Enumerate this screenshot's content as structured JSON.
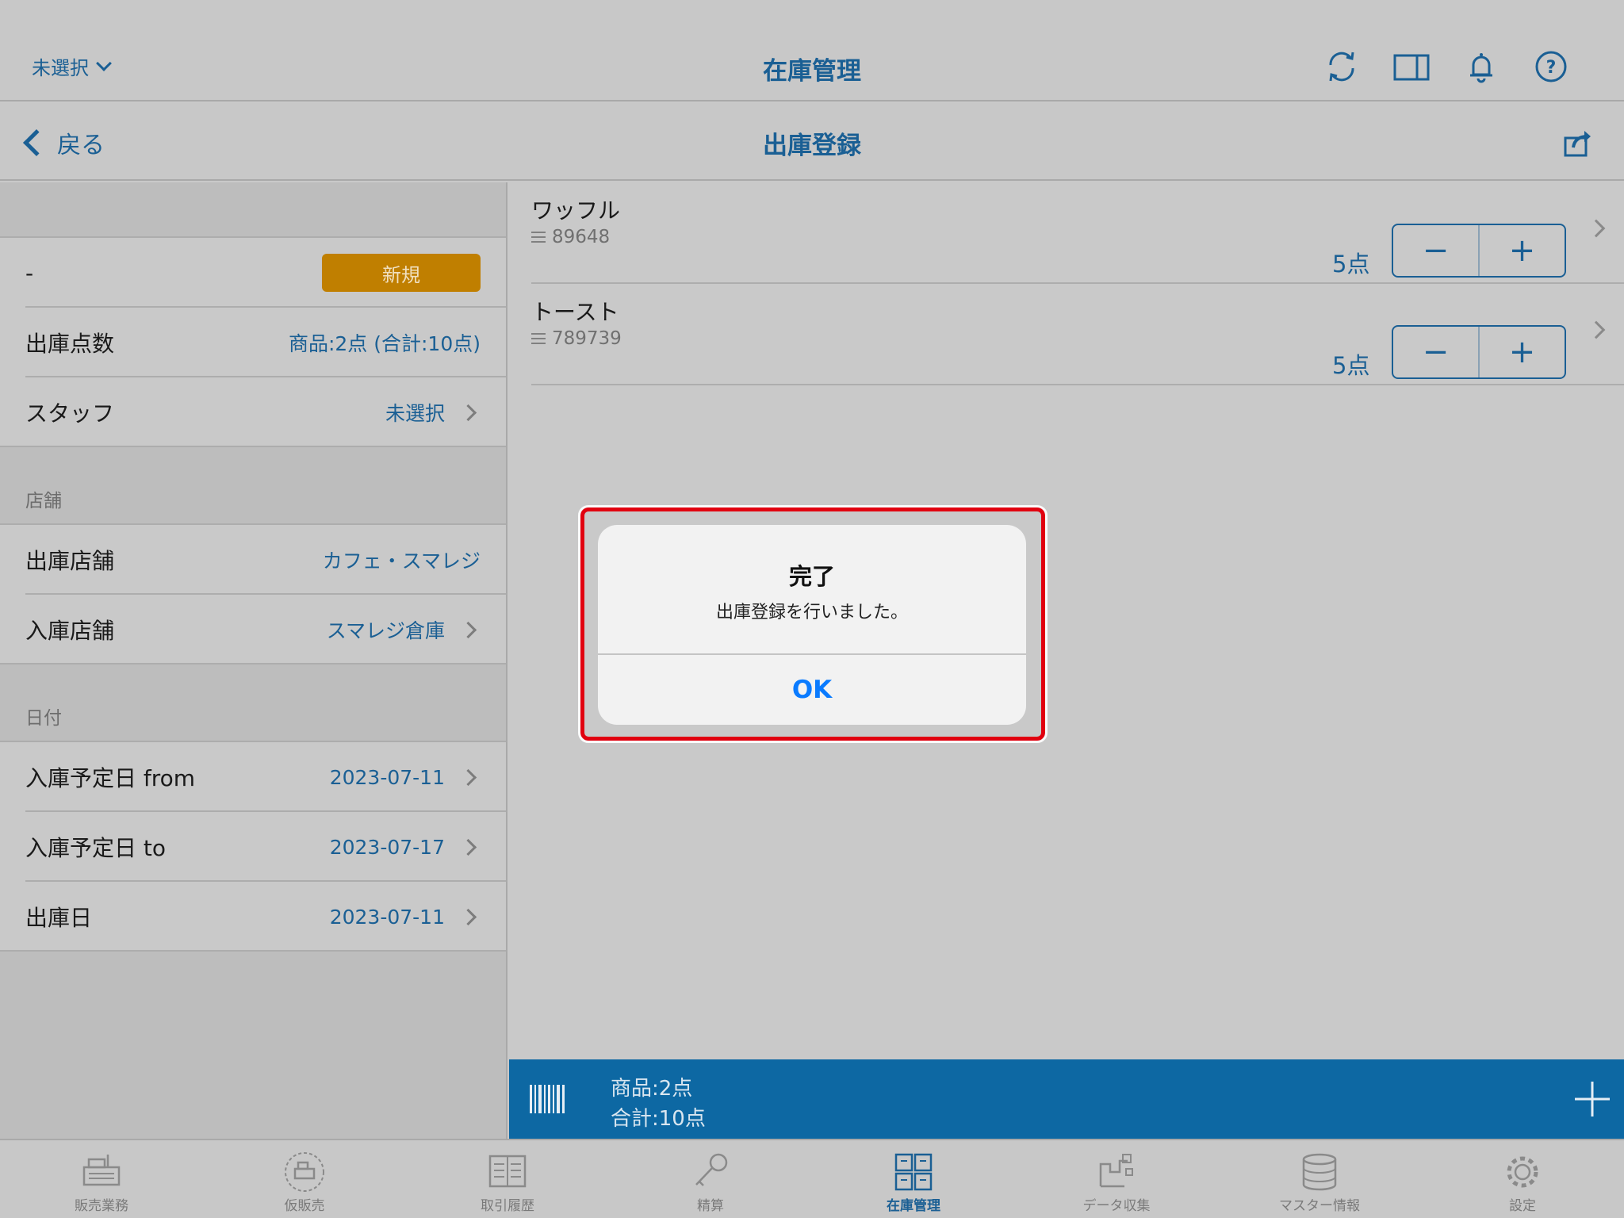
{
  "header": {
    "store_selector": "未選択",
    "title": "在庫管理",
    "icons": [
      "refresh-icon",
      "split-view-icon",
      "bell-icon",
      "help-icon"
    ]
  },
  "subheader": {
    "back_label": "戻る",
    "title": "出庫登録"
  },
  "form": {
    "id_value": "-",
    "status_badge": "新規",
    "count_label": "出庫点数",
    "count_value": "商品:2点 (合計:10点)",
    "staff_label": "スタッフ",
    "staff_value": "未選択",
    "store_section": "店舗",
    "from_store_label": "出庫店舗",
    "from_store_value": "カフェ・スマレジ",
    "to_store_label": "入庫店舗",
    "to_store_value": "スマレジ倉庫",
    "date_section": "日付",
    "date_from_label": "入庫予定日 from",
    "date_from_value": "2023-07-11",
    "date_to_label": "入庫予定日 to",
    "date_to_value": "2023-07-17",
    "ship_date_label": "出庫日",
    "ship_date_value": "2023-07-11"
  },
  "items": [
    {
      "name": "ワッフル",
      "code": "89648",
      "qty": "5点",
      "minus": "−",
      "plus": "+"
    },
    {
      "name": "トースト",
      "code": "789739",
      "qty": "5点",
      "minus": "−",
      "plus": "+"
    }
  ],
  "footer": {
    "products": "商品:2点",
    "total": "合計:10点"
  },
  "dialog": {
    "title": "完了",
    "message": "出庫登録を行いました。",
    "ok": "OK"
  },
  "tabs": [
    {
      "label": "販売業務",
      "icon": "register-icon"
    },
    {
      "label": "仮販売",
      "icon": "temp-register-icon"
    },
    {
      "label": "取引履歴",
      "icon": "history-icon"
    },
    {
      "label": "精算",
      "icon": "key-icon"
    },
    {
      "label": "在庫管理",
      "icon": "inventory-icon",
      "active": true
    },
    {
      "label": "データ収集",
      "icon": "data-collect-icon"
    },
    {
      "label": "マスター情報",
      "icon": "database-icon"
    },
    {
      "label": "設定",
      "icon": "gear-icon"
    }
  ],
  "colors": {
    "accent": "#1a5f94",
    "badge": "#c07f00",
    "footer_bar": "#0d68a3",
    "highlight": "#e1000f",
    "dialog_button": "#0a7bff"
  }
}
